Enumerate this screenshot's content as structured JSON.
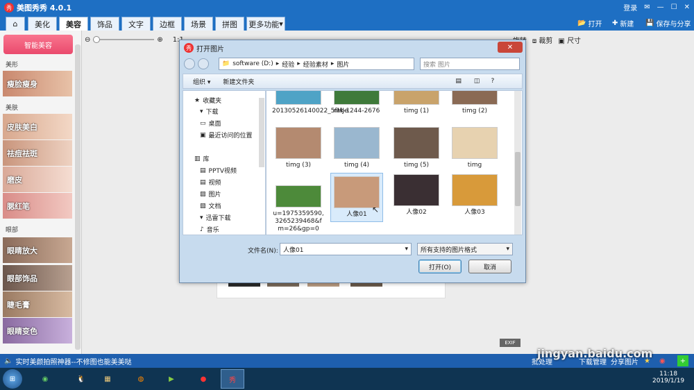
{
  "app": {
    "title": "美图秀秀 4.0.1",
    "login": "登录",
    "window_controls": [
      "minimize-icon",
      "maximize-icon",
      "close-icon"
    ]
  },
  "tabs": [
    "美化",
    "美容",
    "饰品",
    "文字",
    "边框",
    "场景",
    "拼图",
    "更多功能"
  ],
  "active_tab": "美容",
  "right_tools": {
    "open": "打开",
    "new": "新建",
    "save": "保存与分享"
  },
  "toolbar2": {
    "zoom_label": "1:1",
    "crop": "裁剪",
    "size": "尺寸",
    "rotate": "旋转"
  },
  "sidebar": {
    "smart_button": "智能美容",
    "sections": [
      {
        "title": "美形",
        "items": [
          "瘦脸瘦身"
        ]
      },
      {
        "title": "美肤",
        "items": [
          "皮肤美白",
          "祛痘祛斑",
          "磨皮",
          "腮红笔"
        ]
      },
      {
        "title": "眼部",
        "items": [
          "眼睛放大",
          "眼部饰品",
          "睫毛膏",
          "眼睛变色"
        ]
      }
    ]
  },
  "dialog": {
    "title": "打开图片",
    "close": "✕",
    "breadcrumb": [
      "software (D:)",
      "经验",
      "经验素材",
      "图片"
    ],
    "search_placeholder": "搜索 图片",
    "toolbar": {
      "organize": "组织 ▾",
      "new_folder": "新建文件夹"
    },
    "nav": [
      {
        "label": "收藏夹",
        "icon": "star-icon"
      },
      {
        "label": "下载",
        "icon": "download-folder-icon"
      },
      {
        "label": "桌面",
        "icon": "desktop-icon"
      },
      {
        "label": "最近访问的位置",
        "icon": "recent-places-icon"
      },
      {
        "label": "库",
        "icon": "library-icon"
      },
      {
        "label": "PPTV视频",
        "icon": "video-library-icon"
      },
      {
        "label": "视频",
        "icon": "video-library-icon"
      },
      {
        "label": "图片",
        "icon": "pictures-library-icon"
      },
      {
        "label": "文档",
        "icon": "documents-library-icon"
      },
      {
        "label": "迅雷下载",
        "icon": "download-folder-icon"
      },
      {
        "label": "音乐",
        "icon": "music-library-icon"
      }
    ],
    "files": [
      {
        "name": "20130526140022_5fMJe",
        "thumb": "#4fa3c6"
      },
      {
        "name": "ntk-1244-2676",
        "thumb": "#3f7a3a"
      },
      {
        "name": "timg (1)",
        "thumb": "#c9a36b"
      },
      {
        "name": "timg (2)",
        "thumb": "#8a6a54"
      },
      {
        "name": "timg (3)",
        "thumb": "#b48a70"
      },
      {
        "name": "timg (4)",
        "thumb": "#9ab7cf"
      },
      {
        "name": "timg (5)",
        "thumb": "#6e5a4c"
      },
      {
        "name": "timg",
        "thumb": "#e7d2b0"
      },
      {
        "name": "u=1975359590,3265239468&fm=26&gp=0",
        "thumb": "#4d8a3a"
      },
      {
        "name": "人像01",
        "thumb": "#c89a7a"
      },
      {
        "name": "人像02",
        "thumb": "#3a2f33"
      },
      {
        "name": "人像03",
        "thumb": "#d89a3a"
      }
    ],
    "selected_file": "人像01",
    "filename_label": "文件名(N):",
    "filename_value": "人像01",
    "filetype_value": "所有支持的图片格式",
    "open_button": "打开(O)",
    "cancel_button": "取消"
  },
  "statusbar": {
    "message": "实时美颜拍照神器--不修图也能美美哒",
    "batch": "批处理",
    "download": "下载管理",
    "share": "分享图片"
  },
  "exif": "EXIF",
  "taskbar": {
    "time": "11:18",
    "date": "2019/1/19"
  },
  "watermark": "jingyan.baidu.com"
}
